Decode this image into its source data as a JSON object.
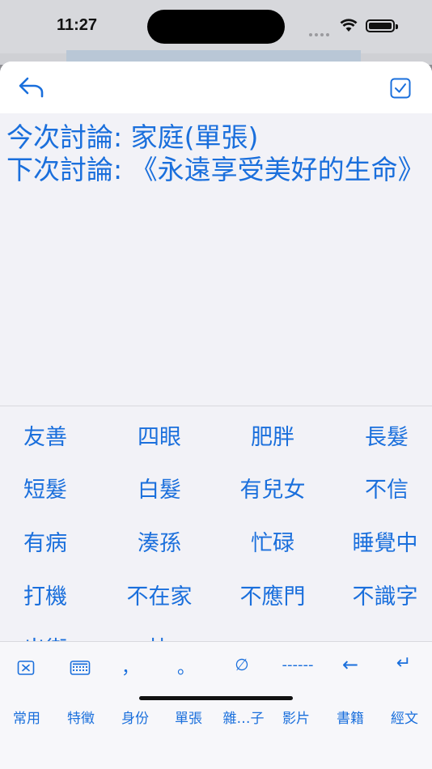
{
  "status": {
    "time": "11:27"
  },
  "editor": {
    "line1": "今次討論: 家庭(單張)",
    "line2": "下次討論: 《永遠享受美好的生命》"
  },
  "phrases": [
    "友善",
    "四眼",
    "肥胖",
    "長髮",
    "短髮",
    "白髮",
    "有兒女",
    "不信",
    "有病",
    "湊孫",
    "忙碌",
    "睡覺中",
    "打機",
    "不在家",
    "不應門",
    "不識字",
    "出街",
    "快"
  ],
  "toolbar": {
    "comma": "，",
    "period": "。",
    "empty_set": "∅",
    "dashes": "------",
    "arrow_left": "←",
    "return": "↵"
  },
  "tabs": [
    "常用",
    "特徵",
    "身份",
    "單張",
    "雜…子",
    "影片",
    "書籍",
    "經文"
  ],
  "colors": {
    "accent": "#1a6fdc",
    "background": "#f2f2f7"
  }
}
